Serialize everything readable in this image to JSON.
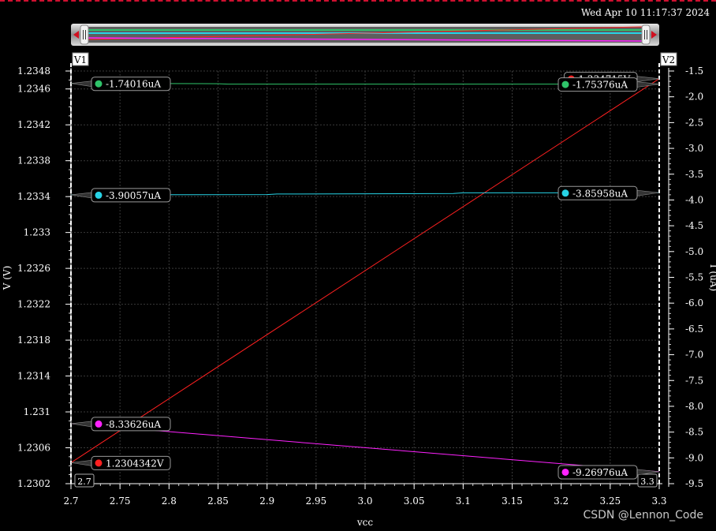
{
  "header": {
    "datetime": "Wed Apr 10 11:17:37 2024"
  },
  "watermark": "CSDN @Lennon_Code",
  "colors": {
    "background": "#000000",
    "grid": "#3a3a3a",
    "axis": "#ffffff",
    "red": "#ff2020",
    "green": "#2fc46a",
    "cyan": "#27d3e6",
    "magenta": "#ff22ff"
  },
  "chart_data": {
    "type": "line",
    "xlabel": "vcc",
    "ylabel": "V (V)",
    "ylabel_right": "I (uA)",
    "xlim": [
      2.7,
      3.3
    ],
    "ylim": [
      1.2302,
      1.2348
    ],
    "ylim_right": [
      -9.5,
      -1.5
    ],
    "x_ticks": [
      "2.7",
      "2.75",
      "2.8",
      "2.85",
      "2.9",
      "2.95",
      "3.0",
      "3.05",
      "3.1",
      "3.15",
      "3.2",
      "3.25",
      "3.3"
    ],
    "y_ticks": [
      "1.2348",
      "1.2346",
      "1.2342",
      "1.2338",
      "1.2334",
      "1.233",
      "1.2326",
      "1.2322",
      "1.2318",
      "1.2314",
      "1.231",
      "1.2306",
      "1.2302"
    ],
    "y_ticks_right": [
      "-1.5",
      "-2.0",
      "-2.5",
      "-3.0",
      "-3.5",
      "-4.0",
      "-4.5",
      "-5.0",
      "-5.5",
      "-6.0",
      "-6.5",
      "-7.0",
      "-7.5",
      "-8.0",
      "-8.5",
      "-9.0",
      "-9.5"
    ],
    "grid": true,
    "series": [
      {
        "axis": "left",
        "color": "#ff2020",
        "x": [
          2.7,
          3.3
        ],
        "y": [
          1.2304342,
          1.234715
        ]
      },
      {
        "axis": "right",
        "color": "#2fc46a",
        "x": [
          2.7,
          2.85,
          2.86,
          3.3
        ],
        "y": [
          -1.74016,
          -1.7465,
          -1.7535,
          -1.75376
        ]
      },
      {
        "axis": "right",
        "color": "#27d3e6",
        "x": [
          2.7,
          2.9,
          2.91,
          3.09,
          3.1,
          3.3
        ],
        "y": [
          -3.90057,
          -3.895,
          -3.885,
          -3.875,
          -3.862,
          -3.85958
        ]
      },
      {
        "axis": "right",
        "color": "#ff22ff",
        "x": [
          2.7,
          3.3
        ],
        "y": [
          -8.33626,
          -9.26976
        ]
      }
    ],
    "cursors": [
      {
        "label": "V1",
        "x": 2.7,
        "value_label": "2.7"
      },
      {
        "label": "V2",
        "x": 3.3,
        "value_label": "3.3"
      }
    ],
    "markers": [
      {
        "text": "1.234715V",
        "color": "#ff2020",
        "axis": "left",
        "x": 3.3,
        "y": 1.234715,
        "side": "left"
      },
      {
        "text": "-1.75376uA",
        "color": "#2fc46a",
        "axis": "right",
        "x": 3.3,
        "y": -1.75376,
        "side": "left"
      },
      {
        "text": "-3.85958uA",
        "color": "#27d3e6",
        "axis": "right",
        "x": 3.3,
        "y": -3.85958,
        "side": "left"
      },
      {
        "text": "-9.26976uA",
        "color": "#ff22ff",
        "axis": "right",
        "x": 3.3,
        "y": -9.26976,
        "side": "left"
      },
      {
        "text": "-1.74016uA",
        "color": "#2fc46a",
        "axis": "right",
        "x": 2.7,
        "y": -1.74016,
        "side": "right"
      },
      {
        "text": "-3.90057uA",
        "color": "#27d3e6",
        "axis": "right",
        "x": 2.7,
        "y": -3.90057,
        "side": "right"
      },
      {
        "text": "-8.33626uA",
        "color": "#ff22ff",
        "axis": "right",
        "x": 2.7,
        "y": -8.33626,
        "side": "right"
      },
      {
        "text": "1.2304342V",
        "color": "#ff2020",
        "axis": "left",
        "x": 2.7,
        "y": 1.2304342,
        "side": "right"
      }
    ]
  }
}
